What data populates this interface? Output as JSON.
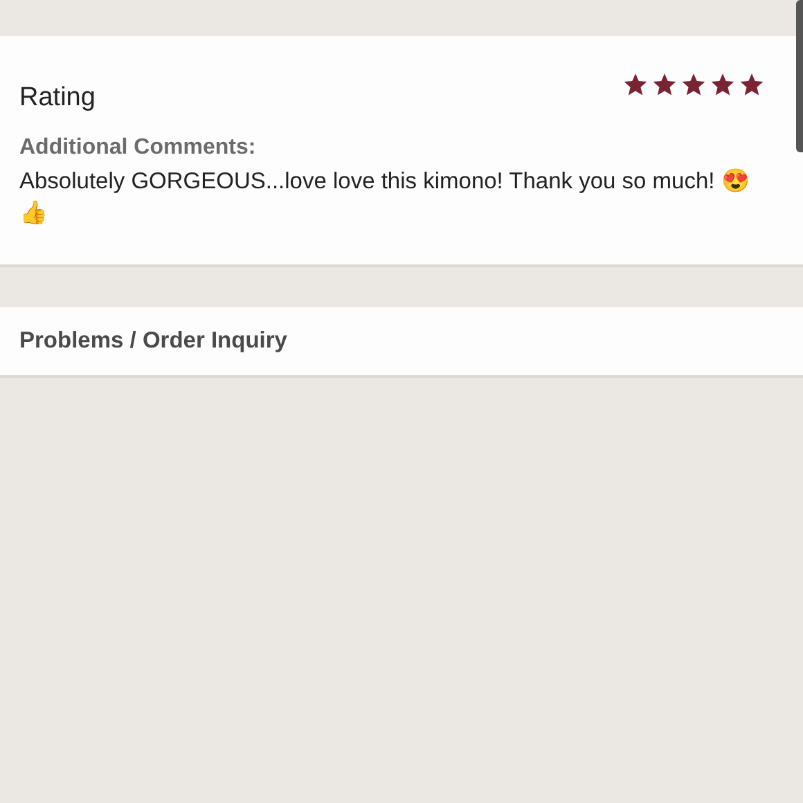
{
  "rating_card": {
    "title": "Rating",
    "stars": 5,
    "comments_label": "Additional Comments:",
    "comment": "Absolutely GORGEOUS...love love this kimono! Thank you so much! 😍 👍"
  },
  "inquiry_card": {
    "title": "Problems / Order Inquiry"
  }
}
